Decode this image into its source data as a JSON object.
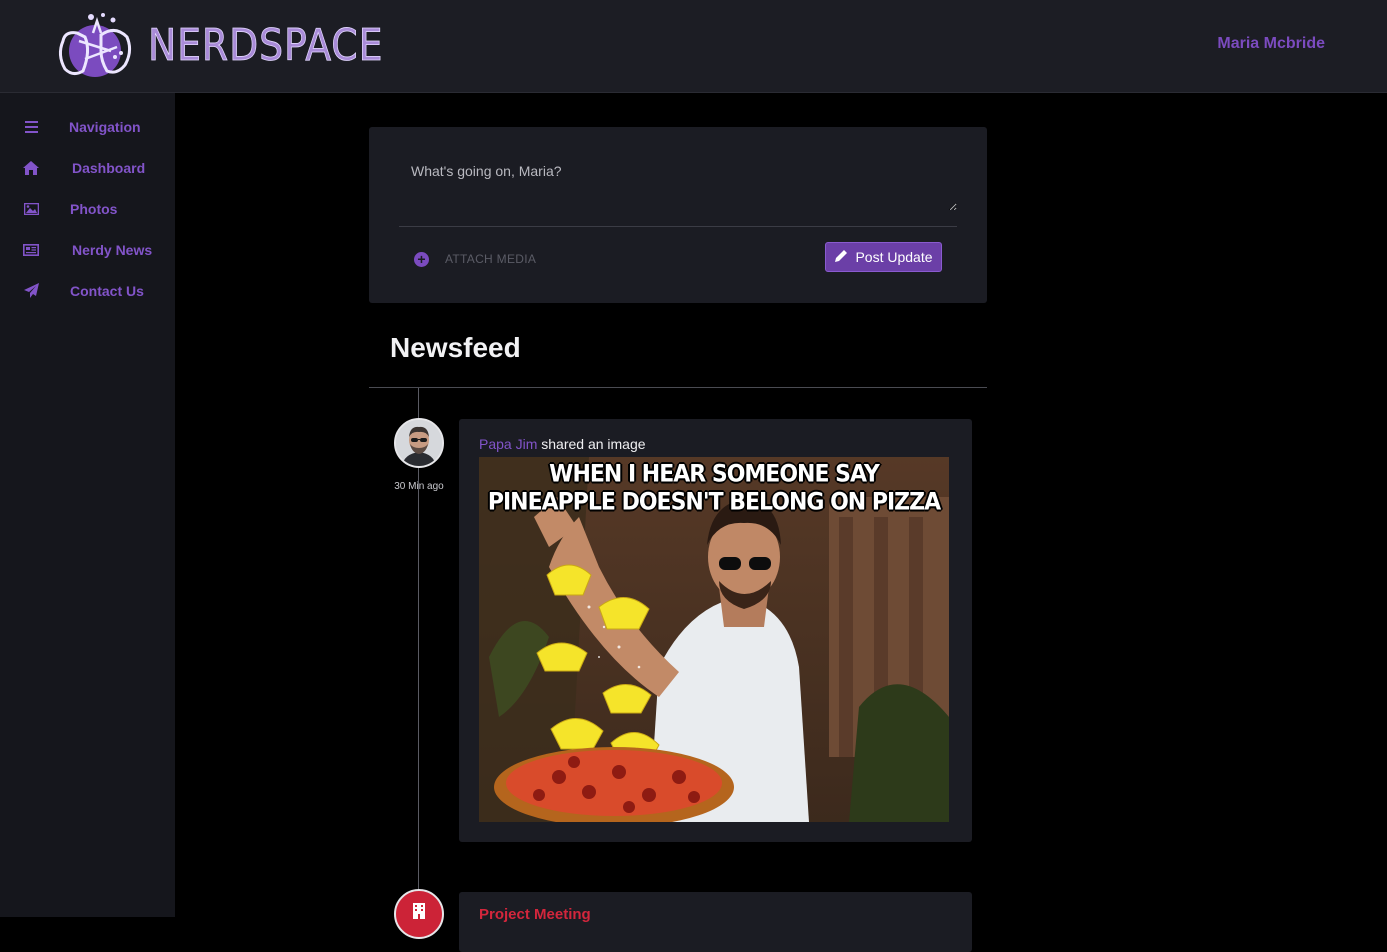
{
  "header": {
    "brand": "NERDSPACE",
    "user_name": "Maria Mcbride"
  },
  "sidebar": {
    "items": [
      {
        "label": "Navigation",
        "icon": "bars-icon"
      },
      {
        "label": "Dashboard",
        "icon": "home-icon"
      },
      {
        "label": "Photos",
        "icon": "image-icon"
      },
      {
        "label": "Nerdy News",
        "icon": "newspaper-icon"
      },
      {
        "label": "Contact Us",
        "icon": "paper-plane-icon"
      }
    ]
  },
  "composer": {
    "placeholder": "What's going on, Maria?",
    "attach_label": "ATTACH MEDIA",
    "post_label": "Post Update"
  },
  "feed": {
    "title": "Newsfeed",
    "posts": [
      {
        "author": "Papa Jim",
        "action": " shared an image",
        "time": "30 Min ago",
        "image_caption_line1": "WHEN I HEAR SOMEONE SAY",
        "image_caption_line2": "PINEAPPLE DOESN'T BELONG ON PIZZA"
      },
      {
        "title": "Project Meeting",
        "icon": "building-icon"
      }
    ]
  },
  "colors": {
    "accent": "#7b4bbf",
    "header_bg": "#1c1d24",
    "sidebar_bg": "#15161c",
    "card_bg": "#1b1c23",
    "event_red": "#cc2337"
  }
}
